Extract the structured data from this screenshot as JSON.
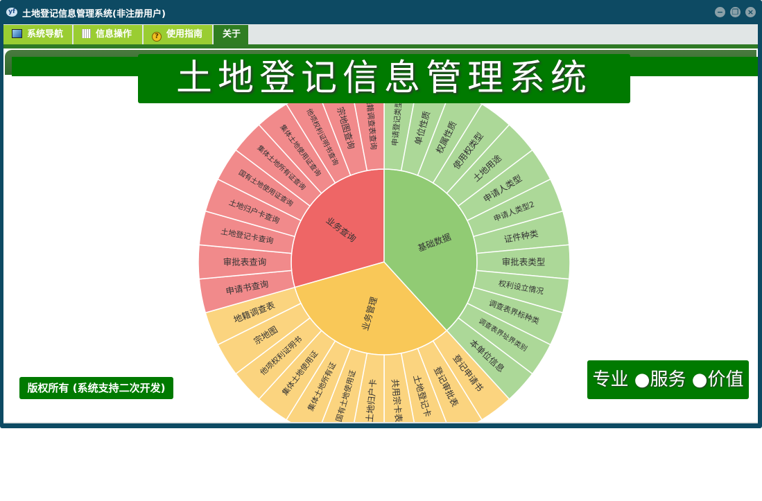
{
  "window": {
    "title": "土地登记信息管理系统(非注册用户)",
    "app_icon": "yf",
    "controls": {
      "minimize": "minimize-icon",
      "restore": "restore-icon",
      "close": "close-icon"
    }
  },
  "menu": [
    {
      "label": "系统导航",
      "icon": "monitor-icon"
    },
    {
      "label": "信息操作",
      "icon": "grid-icon"
    },
    {
      "label": "使用指南",
      "icon": "help-icon"
    },
    {
      "label": "关于",
      "icon": ""
    }
  ],
  "banner": "土地登记信息管理系统",
  "copyright": "版权所有 (系统支持二次开发)",
  "slogan": "专业 ●服务 ●价值",
  "colors": {
    "frame": "#0d4a63",
    "tab": "#9acd32",
    "tab_active": "#2f7d22",
    "brand_green": "#007a00",
    "basic_inner": "#91cb74",
    "basic_outer": "#acd898",
    "manage_inner": "#f9c858",
    "manage_outer": "#fbd47f",
    "query_inner": "#ee6666",
    "query_outer": "#f18a8b"
  },
  "chart_data": {
    "type": "sunburst",
    "title": "",
    "series": [
      {
        "name": "基础数据",
        "color": "#91cb74",
        "leafColor": "#acd898",
        "children": [
          "申请登记类型",
          "单位性质",
          "权属性质",
          "使用权类型",
          "土地用途",
          "申请人类型",
          "申请人类型2",
          "证件种类",
          "审批表类型",
          "权利设立情况",
          "调查表界标种类",
          "调查表界址界类别",
          "本单位信息"
        ]
      },
      {
        "name": "业务管理",
        "color": "#f9c858",
        "leafColor": "#fbd47f",
        "children": [
          "登记申请书",
          "登记审批表",
          "土地登记卡",
          "共用宗卡表",
          "土地归户卡",
          "国有土地使用证",
          "集体土地所有证",
          "集体土地使用证",
          "他项权利证明书",
          "宗地图",
          "地籍调查表"
        ]
      },
      {
        "name": "业务查询",
        "color": "#ee6666",
        "leafColor": "#f18a8b",
        "children": [
          "申请书查询",
          "审批表查询",
          "土地登记卡查询",
          "土地归户卡查询",
          "国有土地使用证查询",
          "集体土地所有证查询",
          "集体土地使用证查询",
          "他项权利证明书查询",
          "宗地图查询",
          "地籍调查表查询"
        ]
      }
    ]
  }
}
